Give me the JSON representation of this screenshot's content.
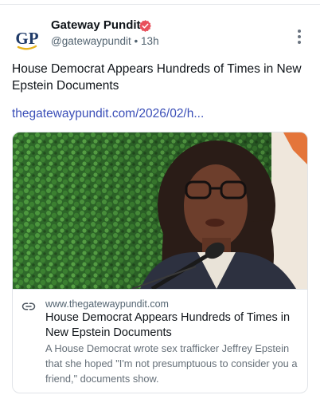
{
  "author": {
    "name": "Gateway Pundit",
    "handle": "@gatewaypundit",
    "separator": "•",
    "time": "13h",
    "avatar_text": "GP",
    "verified": true
  },
  "post": {
    "text": "House Democrat Appears Hundreds of Times in New Epstein Documents",
    "link": "thegatewaypundit.com/2026/02/h..."
  },
  "card": {
    "domain": "www.thegatewaypundit.com",
    "title": "House Democrat Appears Hundreds of Times in New Epstein Documents",
    "description": "A House Democrat wrote sex trafficker Jeffrey Epstein that she hoped \"I'm not presumptuous to consider you a friend,\" documents show."
  },
  "icons": {
    "verified": "verified-badge-icon",
    "more": "more-options-icon",
    "link": "link-icon"
  },
  "colors": {
    "link": "#3b4fb8",
    "verified": "#e8505b",
    "avatar_navy": "#1f3a68",
    "avatar_gold": "#e7b21c"
  }
}
